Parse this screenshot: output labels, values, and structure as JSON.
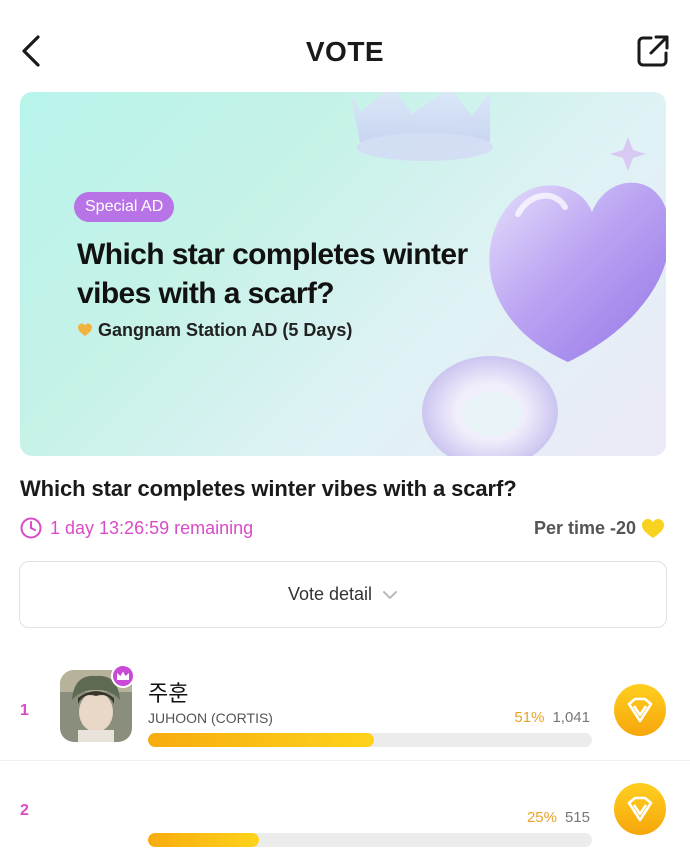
{
  "header": {
    "title": "VOTE"
  },
  "banner": {
    "badge": "Special AD",
    "title": "Which star completes winter vibes with a scarf?",
    "subtitle": "Gangnam Station AD (5 Days)"
  },
  "vote": {
    "question": "Which star completes winter vibes with a scarf?",
    "remaining": "1 day 13:26:59 remaining",
    "per_time": "Per time -20",
    "detail_label": "Vote detail"
  },
  "candidates": [
    {
      "rank": "1",
      "name": "주훈",
      "group": "JUHOON (CORTIS)",
      "percent": "51%",
      "votes": "1,041",
      "share": 0.51
    },
    {
      "rank": "2",
      "name": "",
      "group": "",
      "percent": "25%",
      "votes": "515",
      "share": 0.25
    }
  ],
  "colors": {
    "accent_pink": "#d94bc7",
    "badge_purple": "#b874e6",
    "gold": "#f6a60c",
    "bar_track": "#ececec"
  },
  "icons": {
    "back": "chevron-left-icon",
    "share": "external-link-icon",
    "timer": "clock-icon",
    "heart": "heart-icon",
    "chevron": "chevron-down-icon",
    "vote": "vote-gem-icon",
    "crown": "crown-icon"
  }
}
